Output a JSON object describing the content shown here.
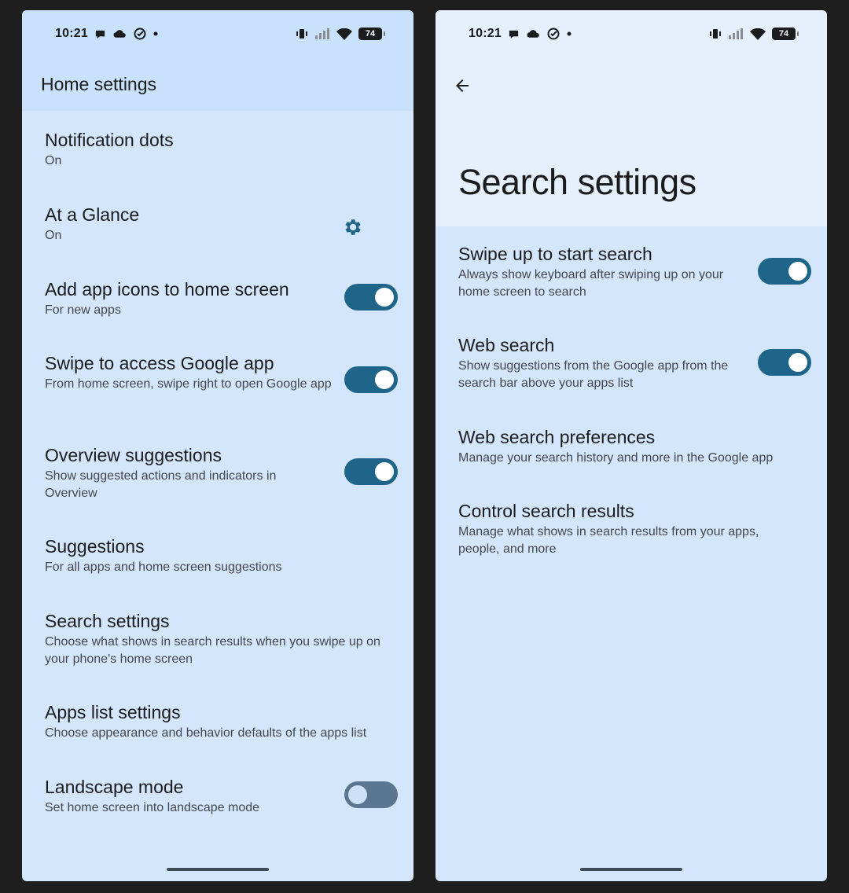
{
  "status": {
    "time": "10:21",
    "battery": "74"
  },
  "home": {
    "title": "Home settings",
    "items": [
      {
        "title": "Notification dots",
        "subtitle": "On"
      },
      {
        "title": "At a Glance",
        "subtitle": "On"
      },
      {
        "title": "Add app icons to home screen",
        "subtitle": "For new apps",
        "toggle": true
      },
      {
        "title": "Swipe to access Google app",
        "subtitle": "From home screen, swipe right to open Google app",
        "toggle": true
      },
      {
        "title": "Overview suggestions",
        "subtitle": "Show suggested actions and indicators in Overview",
        "toggle": true
      },
      {
        "title": "Suggestions",
        "subtitle": "For all apps and home screen suggestions"
      },
      {
        "title": "Search settings",
        "subtitle": "Choose what shows in search results when you swipe up on your phone's home screen"
      },
      {
        "title": "Apps list settings",
        "subtitle": "Choose appearance and behavior defaults of the apps list"
      },
      {
        "title": "Landscape mode",
        "subtitle": "Set home screen into landscape mode",
        "toggle": false
      }
    ]
  },
  "search": {
    "title": "Search settings",
    "items": [
      {
        "title": "Swipe up to start search",
        "subtitle": "Always show keyboard after swiping up on your home screen to search",
        "toggle": true
      },
      {
        "title": "Web search",
        "subtitle": "Show suggestions from the Google app from the search bar above your apps list",
        "toggle": true
      },
      {
        "title": "Web search preferences",
        "subtitle": "Manage your search history and more in the Google app"
      },
      {
        "title": "Control search results",
        "subtitle": "Manage what shows in search results from your apps, people, and more"
      }
    ]
  },
  "colors": {
    "toggle_on": "#1e6589",
    "toggle_off": "#5b7690",
    "background": "#d4e6fb"
  }
}
